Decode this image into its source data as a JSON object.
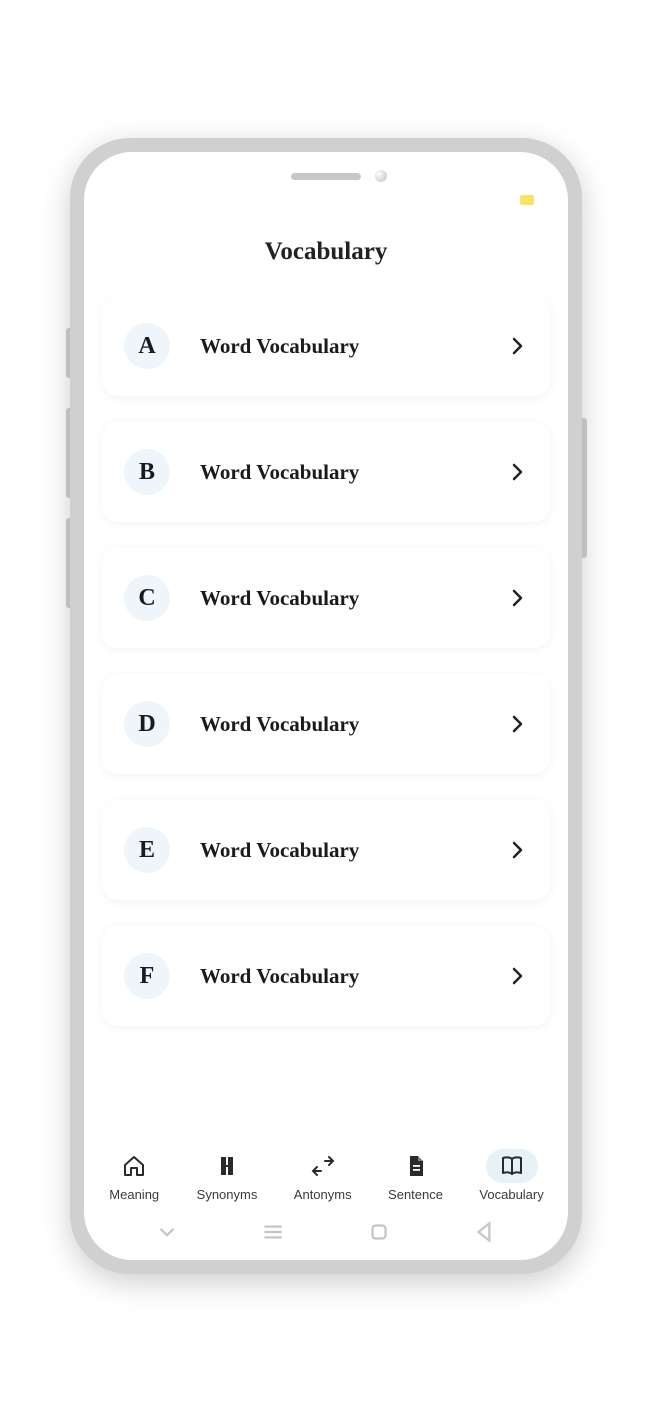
{
  "header": {
    "title": "Vocabulary"
  },
  "list": {
    "items": [
      {
        "letter": "A",
        "label": "Word Vocabulary"
      },
      {
        "letter": "B",
        "label": "Word Vocabulary"
      },
      {
        "letter": "C",
        "label": "Word Vocabulary"
      },
      {
        "letter": "D",
        "label": "Word Vocabulary"
      },
      {
        "letter": "E",
        "label": "Word Vocabulary"
      },
      {
        "letter": "F",
        "label": "Word Vocabulary"
      }
    ]
  },
  "nav": {
    "items": [
      {
        "label": "Meaning",
        "icon": "home-icon",
        "active": false
      },
      {
        "label": "Synonyms",
        "icon": "synonyms-icon",
        "active": false
      },
      {
        "label": "Antonyms",
        "icon": "antonyms-icon",
        "active": false
      },
      {
        "label": "Sentence",
        "icon": "document-icon",
        "active": false
      },
      {
        "label": "Vocabulary",
        "icon": "book-icon",
        "active": true
      }
    ]
  }
}
